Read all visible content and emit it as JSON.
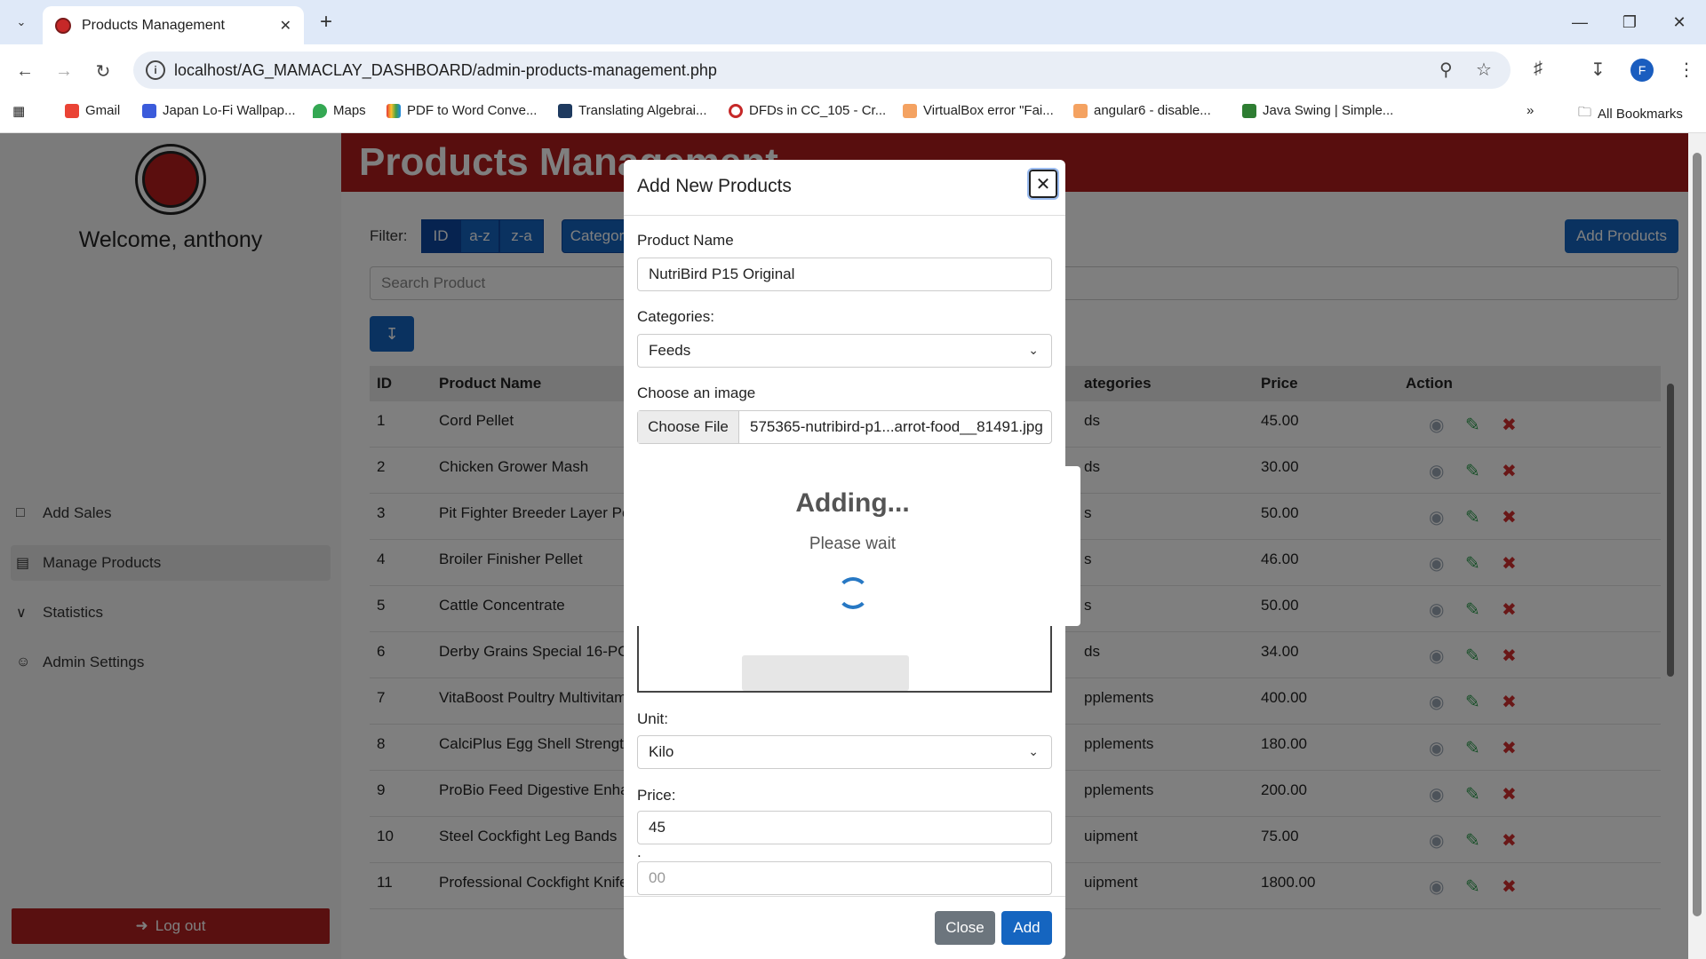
{
  "browser": {
    "tab_title": "Products Management",
    "url": "localhost/AG_MAMACLAY_DASHBOARD/admin-products-management.php",
    "profile_initial": "F",
    "bookmarks": [
      "Gmail",
      "Japan Lo-Fi Wallpap...",
      "Maps",
      "PDF to Word Conve...",
      "Translating Algebrai...",
      "DFDs in CC_105 - Cr...",
      "VirtualBox error \"Fai...",
      "angular6 - disable...",
      "Java Swing | Simple..."
    ],
    "all_bookmarks": "All Bookmarks"
  },
  "sidebar": {
    "welcome": "Welcome, anthony",
    "items": [
      {
        "label": "Add Sales",
        "icon": "cart-icon"
      },
      {
        "label": "Manage Products",
        "icon": "box-icon"
      },
      {
        "label": "Statistics",
        "icon": "chart-icon"
      },
      {
        "label": "Admin Settings",
        "icon": "user-icon"
      }
    ],
    "logout": "Log out"
  },
  "main": {
    "title": "Products Management",
    "filter_label": "Filter:",
    "filters": [
      "ID",
      "a-z",
      "z-a",
      "Categor"
    ],
    "add_products": "Add Products",
    "search_placeholder": "Search Product",
    "columns": [
      "ID",
      "Product Name",
      "ategories",
      "Price",
      "Action"
    ],
    "rows": [
      {
        "id": "1",
        "name": "Cord Pellet",
        "category": "ds",
        "price": "45.00"
      },
      {
        "id": "2",
        "name": "Chicken Grower Mash",
        "category": "ds",
        "price": "30.00"
      },
      {
        "id": "3",
        "name": "Pit Fighter Breeder Layer Pe",
        "category": "s",
        "price": "50.00"
      },
      {
        "id": "4",
        "name": "Broiler Finisher Pellet",
        "category": "s",
        "price": "46.00"
      },
      {
        "id": "5",
        "name": "Cattle Concentrate",
        "category": "s",
        "price": "50.00"
      },
      {
        "id": "6",
        "name": "Derby Grains Special 16-PO",
        "category": "ds",
        "price": "34.00"
      },
      {
        "id": "7",
        "name": "VitaBoost Poultry Multivitam",
        "category": "pplements",
        "price": "400.00"
      },
      {
        "id": "8",
        "name": "CalciPlus Egg Shell Strength",
        "category": "pplements",
        "price": "180.00"
      },
      {
        "id": "9",
        "name": "ProBio Feed Digestive Enha",
        "category": "pplements",
        "price": "200.00"
      },
      {
        "id": "10",
        "name": "Steel Cockfight Leg Bands",
        "category": "uipment",
        "price": "75.00"
      },
      {
        "id": "11",
        "name": "Professional Cockfight Knife",
        "category": "uipment",
        "price": "1800.00"
      }
    ]
  },
  "modal": {
    "title": "Add New Products",
    "product_name_label": "Product Name",
    "product_name_value": "NutriBird P15 Original",
    "categories_label": "Categories:",
    "categories_value": "Feeds",
    "image_label": "Choose an image",
    "choose_file": "Choose File",
    "file_name": "575365-nutribird-p1...arrot-food__81491.jpg",
    "unit_label": "Unit:",
    "unit_value": "Kilo",
    "price_label": "Price:",
    "price_value": "45",
    "cents_label": ".",
    "cents_placeholder": "00",
    "close_button": "Close",
    "add_button": "Add"
  },
  "loading": {
    "title": "Adding...",
    "text": "Please wait"
  },
  "colors": {
    "brand_red": "#b01c1c",
    "primary_blue": "#1565c0",
    "spinner_blue": "#2778c4"
  }
}
